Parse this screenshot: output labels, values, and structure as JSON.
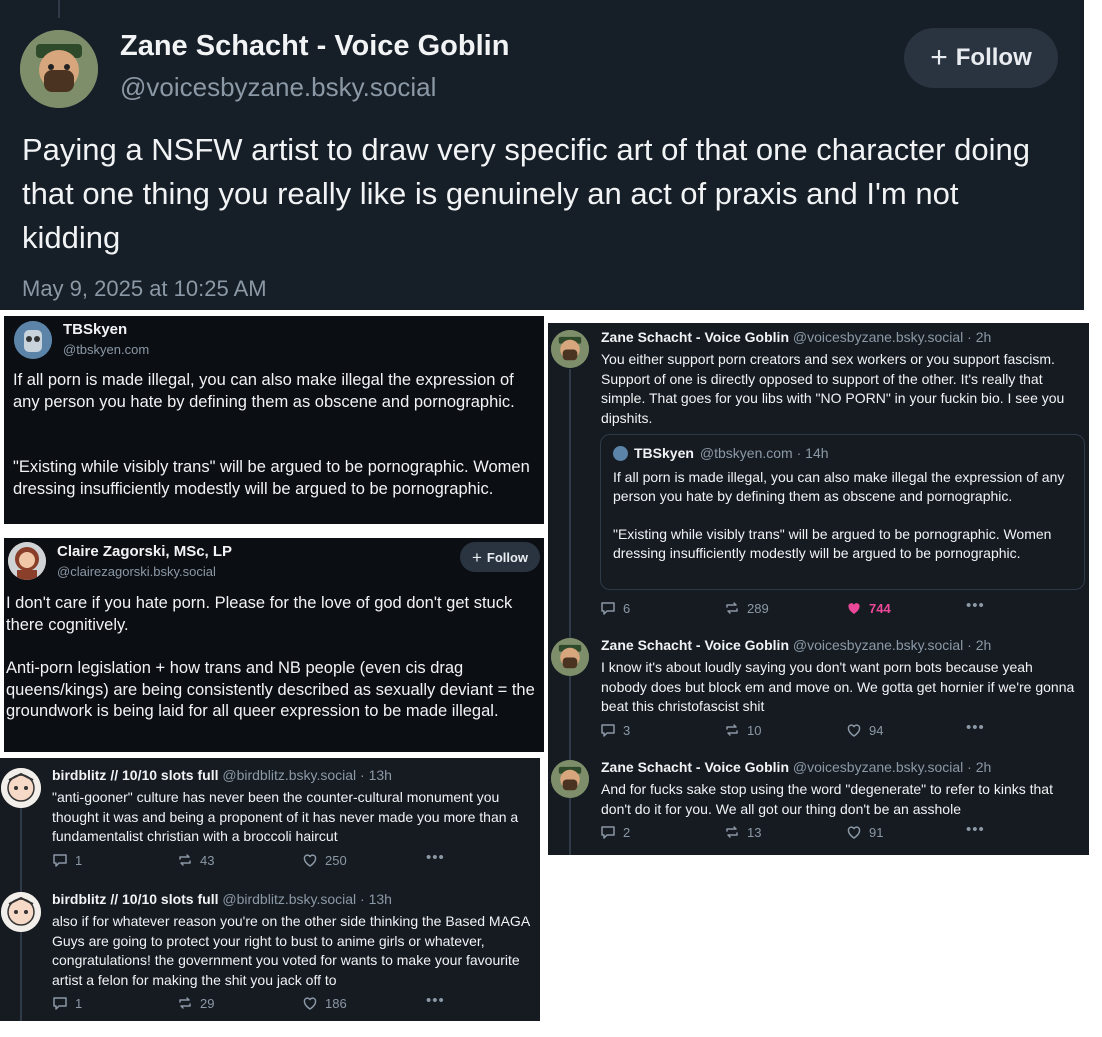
{
  "main_post": {
    "display_name": "Zane Schacht - Voice Goblin",
    "handle": "@voicesbyzane.bsky.social",
    "follow_label": "Follow",
    "text": "Paying a NSFW artist to draw very specific art of that one character doing that one thing you really like is genuinely an act of praxis and I'm not kidding",
    "timestamp": "May 9, 2025 at 10:25 AM"
  },
  "tbskyen_post": {
    "display_name": "TBSkyen",
    "handle": "@tbskyen.com",
    "text_1": "If all porn is made illegal, you can also make illegal the expression of any person you hate by defining them as obscene and pornographic.",
    "text_2": "\"Existing while visibly trans\" will be argued to be pornographic. Women dressing insufficiently modestly will be argued to be pornographic."
  },
  "claire_post": {
    "display_name": "Claire Zagorski, MSc, LP",
    "handle": "@clairezagorski.bsky.social",
    "follow_label": "Follow",
    "text_1": "I don't care if you hate porn. Please for the love of god don't get stuck there cognitively.",
    "text_2": "Anti-porn legislation + how trans and NB people (even cis drag queens/kings) are being consistently described as sexually deviant = the groundwork is being laid for all queer expression to be made illegal."
  },
  "birdblitz_thread": {
    "posts": [
      {
        "display_name": "birdblitz // 10/10 slots full",
        "meta": "@birdblitz.bsky.social · 13h",
        "text": "\"anti-gooner\" culture has never been the counter-cultural monument you thought it was and being a proponent of it has never made you more than a fundamentalist christian with a broccoli haircut",
        "replies": "1",
        "reposts": "43",
        "likes": "250"
      },
      {
        "display_name": "birdblitz // 10/10 slots full",
        "meta": "@birdblitz.bsky.social · 13h",
        "text": "also if for whatever reason you're on the other side thinking the Based MAGA Guys are going to protect your right to bust to anime girls or whatever, congratulations! the government you voted for wants to make your favourite artist a felon for making the shit you jack off to",
        "replies": "1",
        "reposts": "29",
        "likes": "186"
      }
    ]
  },
  "zane_thread": {
    "posts": [
      {
        "display_name": "Zane Schacht - Voice Goblin",
        "meta": "@voicesbyzane.bsky.social · 2h",
        "text": "You either support porn creators and sex workers or you support fascism. Support of one is directly opposed to support of the other. It's really that simple. That goes for you libs with \"NO PORN\" in your fuckin bio. I see you dipshits.",
        "replies": "6",
        "reposts": "289",
        "likes": "744"
      },
      {
        "display_name": "Zane Schacht - Voice Goblin",
        "meta": "@voicesbyzane.bsky.social · 2h",
        "text": "I know it's about loudly saying you don't want porn bots because yeah nobody does but block em and move on. We gotta get hornier if we're gonna beat this christofascist shit",
        "replies": "3",
        "reposts": "10",
        "likes": "94"
      },
      {
        "display_name": "Zane Schacht - Voice Goblin",
        "meta": "@voicesbyzane.bsky.social · 2h",
        "text": "And for fucks sake stop using the word \"degenerate\" to refer to kinks that don't do it for you. We all got our thing don't be an asshole",
        "replies": "2",
        "reposts": "13",
        "likes": "91"
      }
    ],
    "quote": {
      "display_name": "TBSkyen",
      "meta": "@tbskyen.com · 14h",
      "text_1": "If all porn is made illegal, you can also make illegal the expression of any person you hate by defining them as obscene and pornographic.",
      "text_2": "\"Existing while visibly trans\" will be argued to be pornographic. Women dressing insufficiently modestly will be argued to be pornographic."
    }
  },
  "colors": {
    "liked": "#ec4899",
    "muted": "#8b98a5",
    "follow_bg": "#2a3441"
  }
}
